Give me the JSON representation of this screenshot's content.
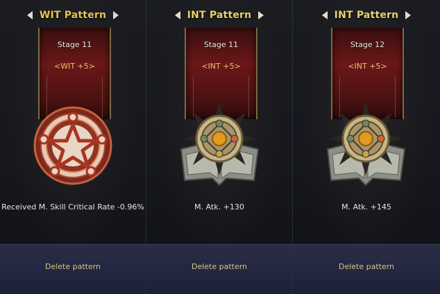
{
  "panels": [
    {
      "title": "WIT Pattern",
      "stage": "Stage 11",
      "bonus": "<WIT +5>",
      "stat": "Received M. Skill Critical Rate -0.96%",
      "delete_label": "Delete pattern",
      "emblem": "wit-pentagram-seal",
      "title_color": "#e7c64e"
    },
    {
      "title": "INT Pattern",
      "stage": "Stage 11",
      "bonus": "<INT +5>",
      "stat": "M. Atk. +130",
      "delete_label": "Delete pattern",
      "emblem": "int-sun-book",
      "title_color": "#e8d26b"
    },
    {
      "title": "INT Pattern",
      "stage": "Stage 12",
      "bonus": "<INT +5>",
      "stat": "M. Atk. +145",
      "delete_label": "Delete pattern",
      "emblem": "int-sun-book",
      "title_color": "#e8d26b"
    }
  ],
  "icons": {
    "prev": "chevron-left-icon",
    "next": "chevron-right-icon"
  }
}
